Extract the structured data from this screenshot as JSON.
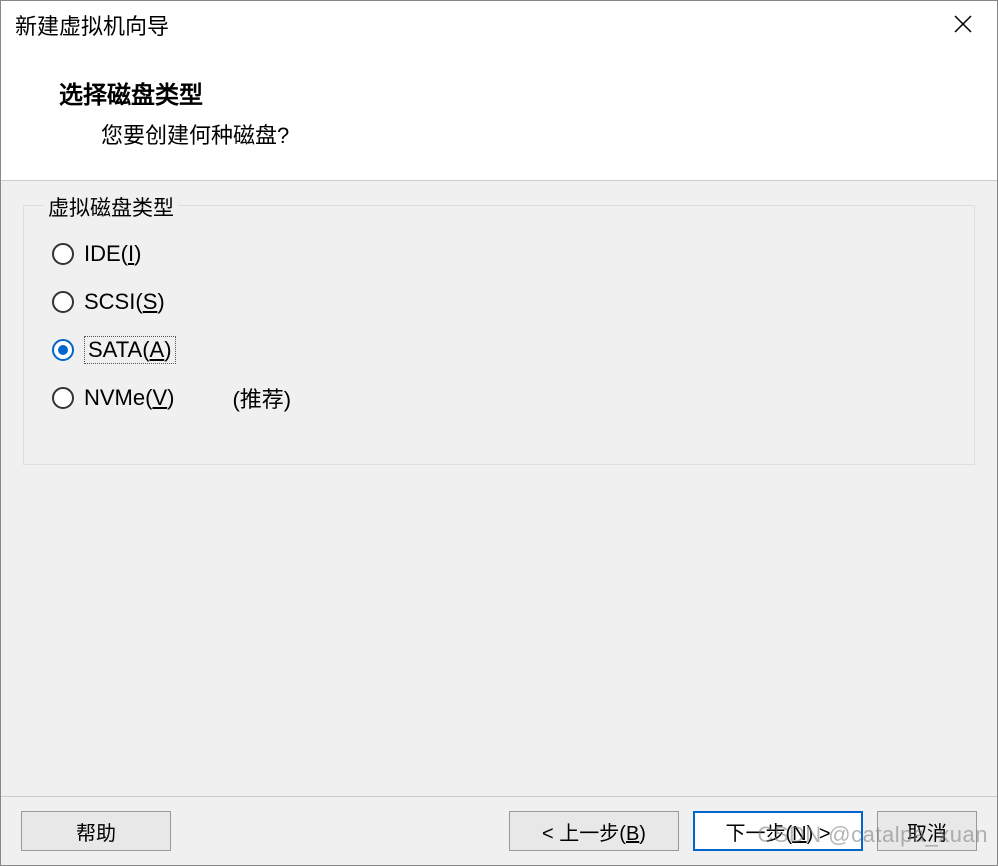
{
  "window": {
    "title": "新建虚拟机向导"
  },
  "header": {
    "title": "选择磁盘类型",
    "subtitle": "您要创建何种磁盘?"
  },
  "group": {
    "legend": "虚拟磁盘类型",
    "options": [
      {
        "label_pre": "IDE(",
        "mnemonic": "I",
        "label_post": ")",
        "selected": false,
        "hint": ""
      },
      {
        "label_pre": "SCSI(",
        "mnemonic": "S",
        "label_post": ")",
        "selected": false,
        "hint": ""
      },
      {
        "label_pre": "SATA(",
        "mnemonic": "A",
        "label_post": ")",
        "selected": true,
        "hint": ""
      },
      {
        "label_pre": "NVMe(",
        "mnemonic": "V",
        "label_post": ")",
        "selected": false,
        "hint": "(推荐)"
      }
    ]
  },
  "footer": {
    "help": "帮助",
    "back_pre": "< 上一步(",
    "back_mn": "B",
    "back_post": ")",
    "next_pre": "下一步(",
    "next_mn": "N",
    "next_post": ") >",
    "cancel": "取消"
  },
  "watermark": "CSDN @catalpa_xuan"
}
